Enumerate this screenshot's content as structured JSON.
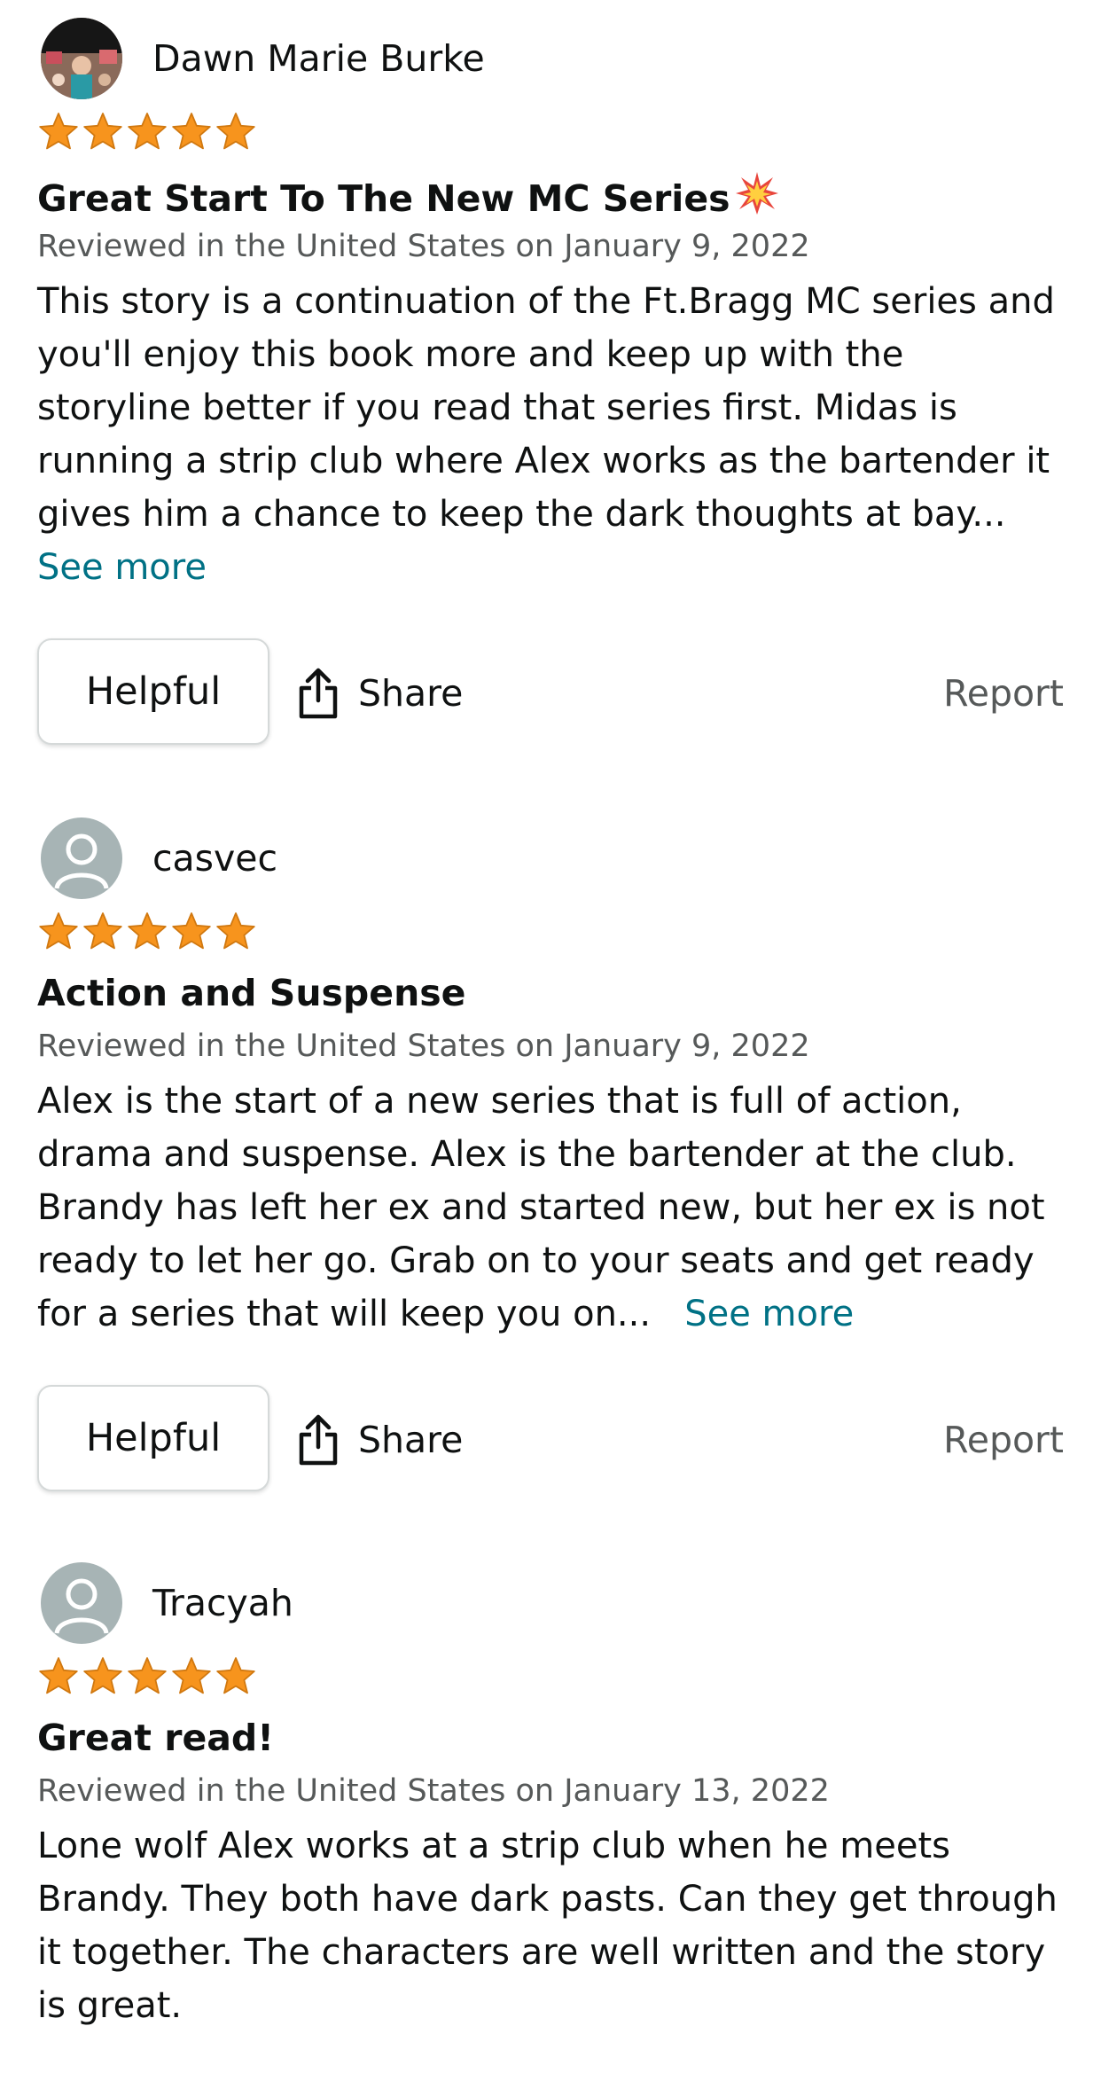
{
  "reviews": [
    {
      "reviewer": "Dawn Marie Burke",
      "avatar": "photo-avatar",
      "rating": 5,
      "title": "Great Start To The New MC Series",
      "title_icon": "collision-emoji",
      "meta": "Reviewed in the United States on January 9, 2022",
      "body": "This story is a continuation of the Ft.Bragg MC series and you'll enjoy this book more and keep up with the storyline better if you read that series first. Midas is running a strip club where Alex works as the bartender it gives him a chance to keep the dark thoughts at bay...",
      "see_more": "See more",
      "helpful": "Helpful",
      "share": "Share",
      "report": "Report"
    },
    {
      "reviewer": "casvec",
      "avatar": "default-avatar",
      "rating": 5,
      "title": "Action and Suspense",
      "meta": "Reviewed in the United States on January 9, 2022",
      "body": "Alex is the start of a new series that is full of action, drama and suspense. Alex is the bartender at the club. Brandy has left her ex and started new, but her ex is not ready to let her go. Grab on to your seats and get ready for a series that will keep you on...",
      "see_more": "See more",
      "helpful": "Helpful",
      "share": "Share",
      "report": "Report"
    },
    {
      "reviewer": "Tracyah",
      "avatar": "default-avatar",
      "rating": 5,
      "title": "Great read!",
      "meta": "Reviewed in the United States on January 13, 2022",
      "body": "Lone wolf Alex works at a strip club when he meets Brandy. They both have dark pasts. Can they get through it together. The characters are well written and the story is great."
    }
  ],
  "colors": {
    "star": "#f7941d",
    "link": "#007185",
    "meta": "#565959",
    "avatar_default": "#a7b4b5"
  }
}
